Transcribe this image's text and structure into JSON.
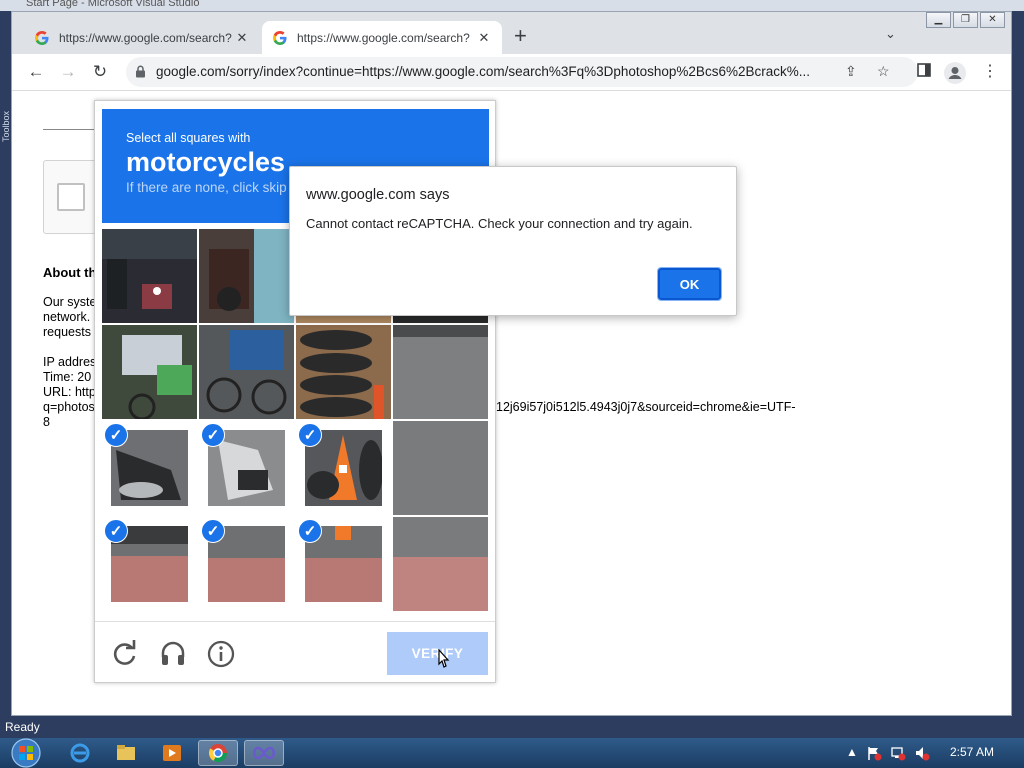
{
  "ide": {
    "window_title": "Start Page - Microsoft Visual Studio",
    "toolbox_label": "Toolbox",
    "status": "Ready"
  },
  "browser": {
    "tabs": [
      {
        "title": "https://www.google.com/search?",
        "active": false
      },
      {
        "title": "https://www.google.com/search?",
        "active": true
      }
    ],
    "url": "google.com/sorry/index?continue=https://www.google.com/search%3Fq%3Dphotoshop%2Bcs6%2Bcrack%...",
    "window_controls": [
      "▁",
      "❐",
      "✕"
    ]
  },
  "page": {
    "about_heading": "About th",
    "paragraph_lines": [
      "Our syste",
      "network.",
      "requests"
    ],
    "info_lines": [
      "IP addres",
      "Time: 20",
      "URL: http",
      "q=photos"
    ],
    "url_tail": "12j69i57j0i512l5.4943j0j7&sourceid=chrome&ie=UTF-",
    "url_tail_2": "8"
  },
  "captcha": {
    "instruction": "Select all squares with",
    "object": "motorcycles",
    "skip_hint": "If there are none, click skip",
    "verify_label": "VERIFY",
    "selected_tiles": [
      8,
      9,
      10,
      12,
      13,
      14
    ],
    "accent_color": "#1a73e8"
  },
  "dialog": {
    "title": "www.google.com says",
    "message": "Cannot contact reCAPTCHA. Check your connection and try again.",
    "ok_label": "OK"
  },
  "taskbar": {
    "clock": "2:57 AM"
  }
}
